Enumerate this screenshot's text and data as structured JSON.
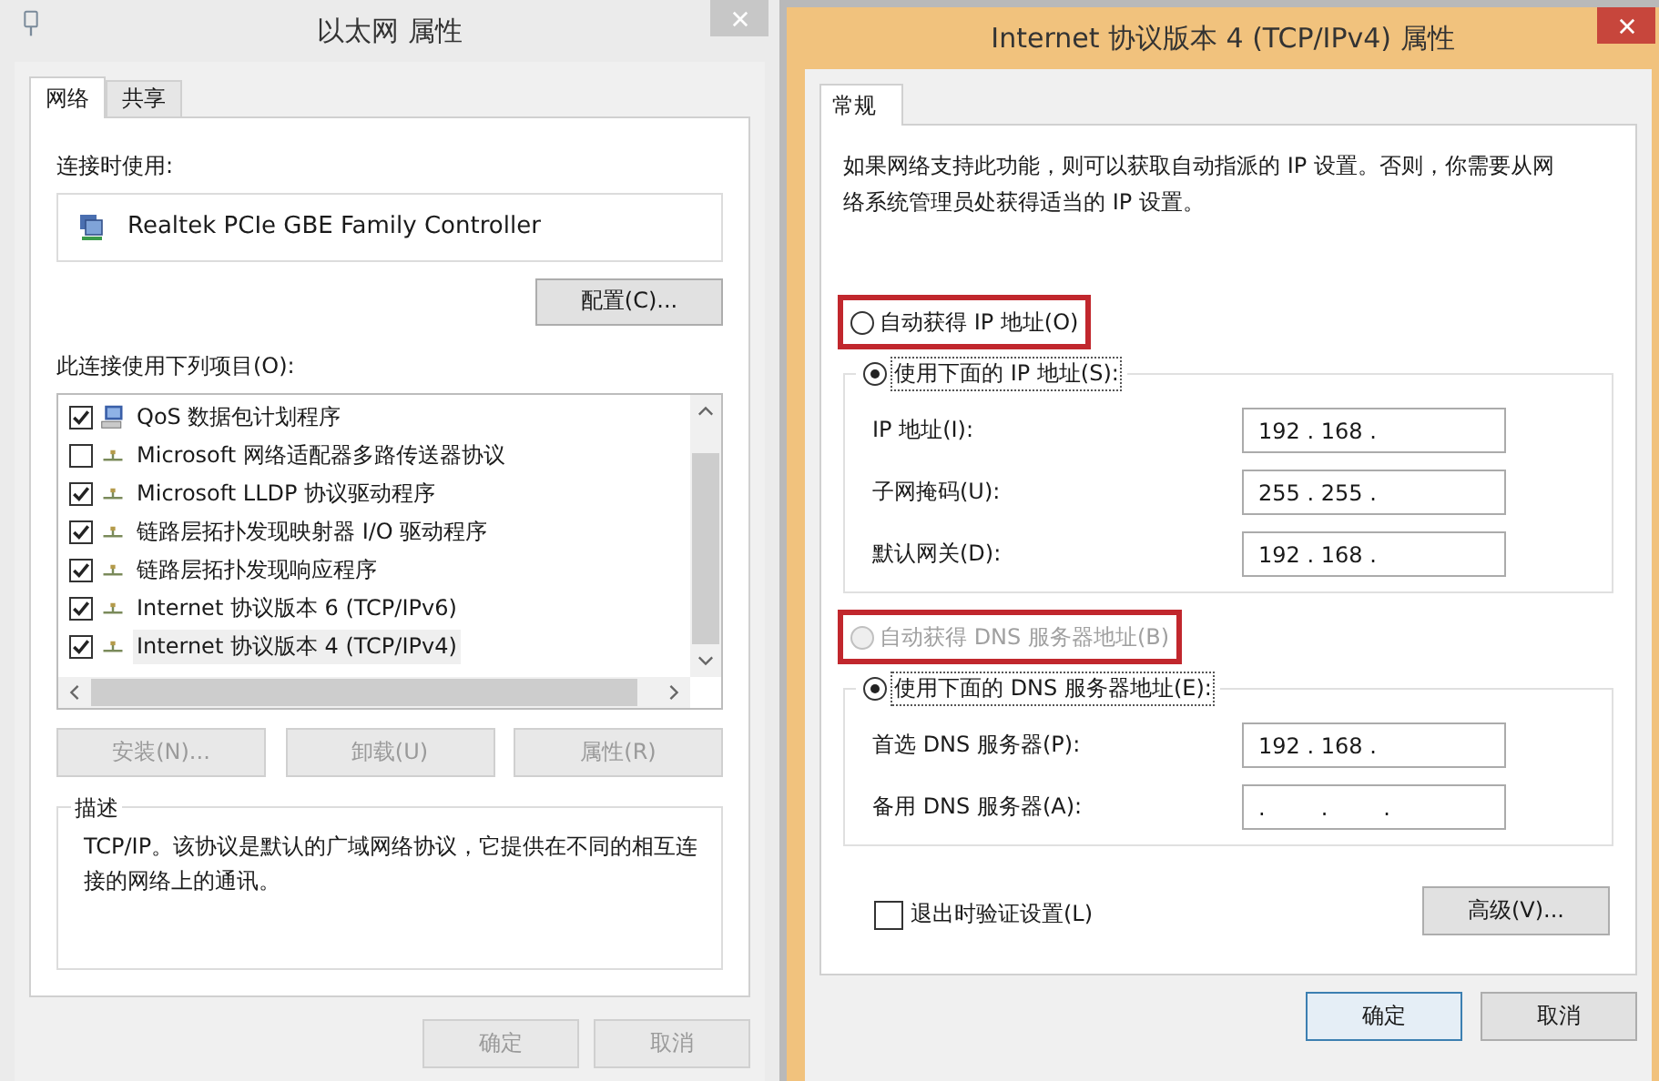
{
  "left_window": {
    "title": "以太网 属性",
    "active": false,
    "tabs": [
      {
        "label": "网络",
        "selected": true
      },
      {
        "label": "共享",
        "selected": false
      }
    ],
    "connect_using_label": "连接时使用:",
    "adapter": "Realtek PCIe GBE Family Controller",
    "configure_button": "配置(C)...",
    "items_label": "此连接使用下列项目(O):",
    "items": [
      {
        "label": "QoS 数据包计划程序",
        "kind": "service",
        "checked": true,
        "selected": false
      },
      {
        "label": "Microsoft 网络适配器多路传送器协议",
        "kind": "protocol",
        "checked": false,
        "selected": false
      },
      {
        "label": "Microsoft LLDP 协议驱动程序",
        "kind": "protocol",
        "checked": true,
        "selected": false
      },
      {
        "label": "链路层拓扑发现映射器 I/O 驱动程序",
        "kind": "protocol",
        "checked": true,
        "selected": false
      },
      {
        "label": "链路层拓扑发现响应程序",
        "kind": "protocol",
        "checked": true,
        "selected": false
      },
      {
        "label": "Internet 协议版本 6 (TCP/IPv6)",
        "kind": "protocol",
        "checked": true,
        "selected": false
      },
      {
        "label": "Internet 协议版本 4 (TCP/IPv4)",
        "kind": "protocol",
        "checked": true,
        "selected": true
      }
    ],
    "item_buttons": [
      {
        "label": "安装(N)...",
        "disabled": true
      },
      {
        "label": "卸载(U)",
        "disabled": true
      },
      {
        "label": "属性(R)",
        "disabled": true
      }
    ],
    "description_title": "描述",
    "description": "TCP/IP。该协议是默认的广域网络协议，它提供在不同的相互连接的网络上的通讯。",
    "buttons": [
      {
        "label": "确定",
        "disabled": true
      },
      {
        "label": "取消",
        "disabled": true
      }
    ]
  },
  "right_window": {
    "title": "Internet 协议版本 4 (TCP/IPv4) 属性",
    "active": true,
    "tabs": [
      {
        "label": "常规",
        "selected": true
      }
    ],
    "intro": "如果网络支持此功能，则可以获取自动指派的 IP 设置。否则，你需要从网络系统管理员处获得适当的 IP 设置。",
    "ip_modes": [
      {
        "label": "自动获得 IP 地址(O)",
        "selected": false,
        "disabled": false,
        "highlighted": true
      },
      {
        "label": "使用下面的 IP 地址(S):",
        "selected": true,
        "disabled": false,
        "highlighted": false
      }
    ],
    "ip_fields": [
      {
        "label": "IP 地址(I):",
        "value": "192 . 168 ."
      },
      {
        "label": "子网掩码(U):",
        "value": "255 . 255 ."
      },
      {
        "label": "默认网关(D):",
        "value": "192 . 168 ."
      }
    ],
    "dns_modes": [
      {
        "label": "自动获得 DNS 服务器地址(B)",
        "selected": false,
        "disabled": true,
        "highlighted": true
      },
      {
        "label": "使用下面的 DNS 服务器地址(E):",
        "selected": true,
        "disabled": false,
        "highlighted": false
      }
    ],
    "dns_fields": [
      {
        "label": "首选 DNS 服务器(P):",
        "value": "192 . 168 ."
      },
      {
        "label": "备用 DNS 服务器(A):",
        "value": ".        .        ."
      }
    ],
    "validate": {
      "label": "退出时验证设置(L)",
      "checked": false
    },
    "advanced_button": "高级(V)...",
    "buttons": [
      {
        "label": "确定",
        "default": true
      },
      {
        "label": "取消",
        "default": false
      }
    ]
  }
}
